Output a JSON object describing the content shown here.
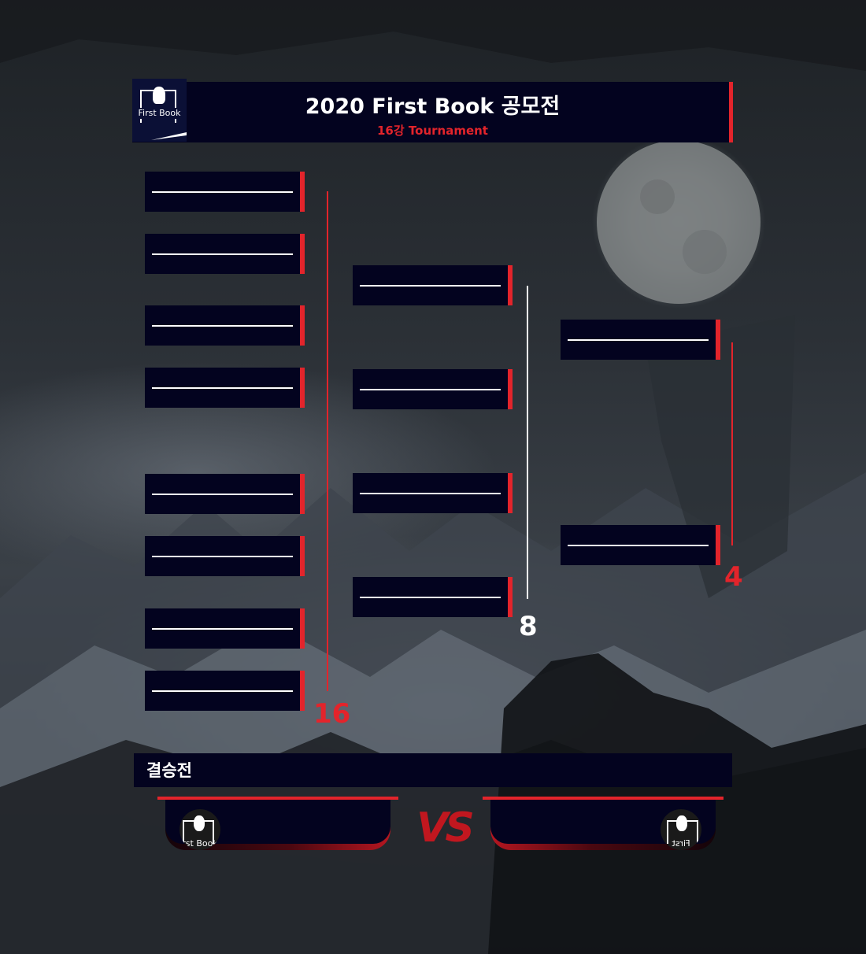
{
  "header": {
    "logo_text": "First Book",
    "title": "2020 First Book 공모전",
    "subtitle": "16강 Tournament"
  },
  "bracket": {
    "round_labels": {
      "r16": "16",
      "r8": "8",
      "r4": "4"
    },
    "round16_count": 8,
    "round8_count": 4,
    "round4_count": 2
  },
  "final": {
    "label": "결승전",
    "vs_text": "VS",
    "left_logo_text": "rst Book",
    "right_logo_text": "First Book"
  },
  "colors": {
    "accent": "#e3242b",
    "panel": "#03031f",
    "line_white": "#ffffff"
  },
  "icons": [
    "first-book-logo-icon",
    "moon-icon"
  ]
}
